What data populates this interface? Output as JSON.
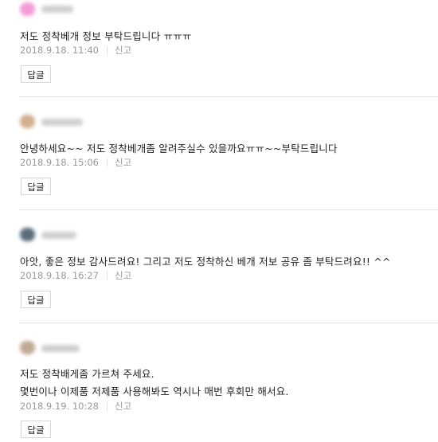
{
  "comments": [
    {
      "lines": [
        "저도 정착베개 정보 부탁드립니다 ㅠㅠㅠ"
      ],
      "date": "2018.9.18. 11:40",
      "report_label": "신고",
      "reply_label": "답글",
      "avatar_color": "#f28ad1"
    },
    {
      "lines": [
        "안녕하세요~~ 저도 정착베개좀 알려주실수 있을까요ㅠㅠ~~부탁드립니다"
      ],
      "date": "2018.9.18. 15:06",
      "report_label": "신고",
      "reply_label": "답글",
      "avatar_color": "#c9a27a"
    },
    {
      "lines": [
        "아앗, 좋은 정보 감사드려요! 그리고 저도 정착하신 베개 저보 공유 좀 부탁드려요!! ^^"
      ],
      "date": "2018.9.18. 16:27",
      "report_label": "신고",
      "reply_label": "답글",
      "avatar_color": "#3e5566"
    },
    {
      "lines": [
        "저도 정착배게좀 가르쳐 주세요.",
        "몇번이나 이제품 저제품 사용해봐도 역시나 매번 후회만 해서요."
      ],
      "date": "2018.9.19. 10:28",
      "report_label": "신고",
      "reply_label": "답글",
      "avatar_color": "#b59a80"
    }
  ]
}
